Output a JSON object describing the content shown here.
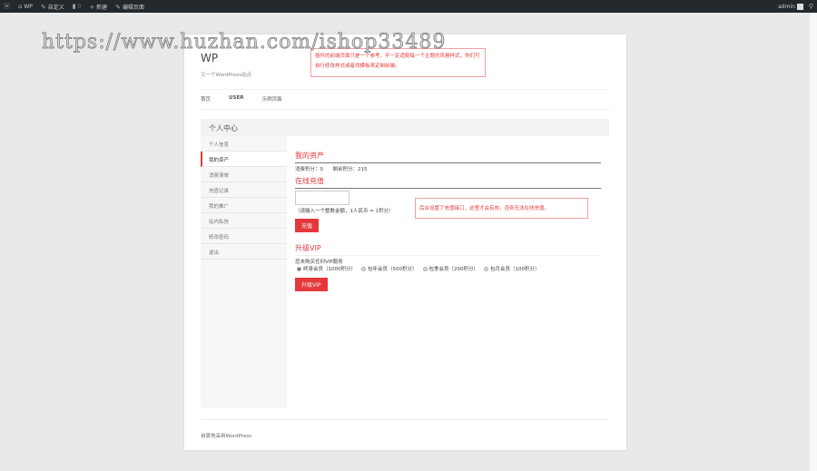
{
  "adminbar": {
    "items": [
      "WP",
      "自定义",
      "0",
      "新建",
      "编辑页面"
    ],
    "user": "admin"
  },
  "site": {
    "title": "WP",
    "tagline": "又一个WordPress站点",
    "nav": [
      "首页",
      "USER",
      "示例页面"
    ]
  },
  "usercenter": {
    "title": "个人中心",
    "menu": [
      "个人信息",
      "我的资产",
      "消费清单",
      "充值记录",
      "我的推广",
      "站内私信",
      "修改密码",
      "退出"
    ],
    "active": 1
  },
  "assets": {
    "title": "我的资产",
    "consumed": "消费积分：0",
    "remaining": "剩余积分：215"
  },
  "recharge": {
    "title": "在线充值",
    "hint": "（请输入一个整数金额，1人民币 = 1积分）",
    "button": "充值"
  },
  "vip": {
    "title": "升级VIP",
    "status": "您未购买任何VIP服务",
    "options": [
      "终身会员（1000积分）",
      "包年会员（500积分）",
      "包季会员（200积分）",
      "包月会员（100积分）"
    ],
    "button": "升级VIP"
  },
  "notes": {
    "top": "插件的前端页面只是一个参考，不一定适配每一个主题的风格样式，你们可自行修改样式或者找模板来定制前端。",
    "recharge": "后台设置了充值接口，这里才会有效，否则无法在线充值。"
  },
  "footer": "自豪地采用WordPress",
  "watermark": "https://www.huzhan.com/ishop33489"
}
